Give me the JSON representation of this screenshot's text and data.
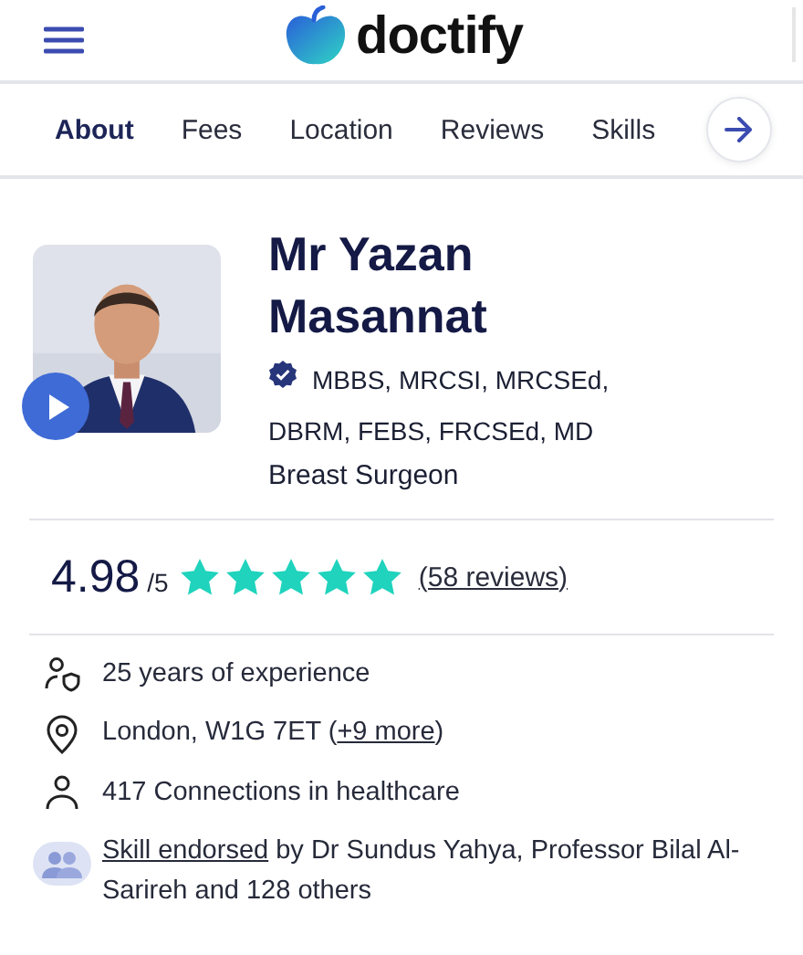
{
  "header": {
    "logo_text": "doctify"
  },
  "tabs": [
    {
      "label": "About",
      "selected": true
    },
    {
      "label": "Fees",
      "selected": false
    },
    {
      "label": "Location",
      "selected": false
    },
    {
      "label": "Reviews",
      "selected": false
    },
    {
      "label": "Skills",
      "selected": false
    }
  ],
  "profile": {
    "name": "Mr Yazan Masannat",
    "verified": true,
    "qualifications": "MBBS, MRCSI, MRCSEd, DBRM, FEBS, FRCSEd, MD",
    "specialty": "Breast Surgeon"
  },
  "rating": {
    "score": "4.98",
    "scale": "/5",
    "stars": 5,
    "reviews_link": "(58 reviews)"
  },
  "facts": [
    {
      "kind": "experience",
      "prefix": "25 years of experience"
    },
    {
      "kind": "location",
      "prefix": "London, W1G 7ET (",
      "link": "+9 more",
      "suffix": ")"
    },
    {
      "kind": "connections",
      "prefix": "417 Connections in healthcare"
    },
    {
      "kind": "endorsement",
      "link": "Skill endorsed",
      "suffix": " by Dr Sundus Yahya, Professor Bilal Al-Sarireh and 128 others"
    }
  ]
}
